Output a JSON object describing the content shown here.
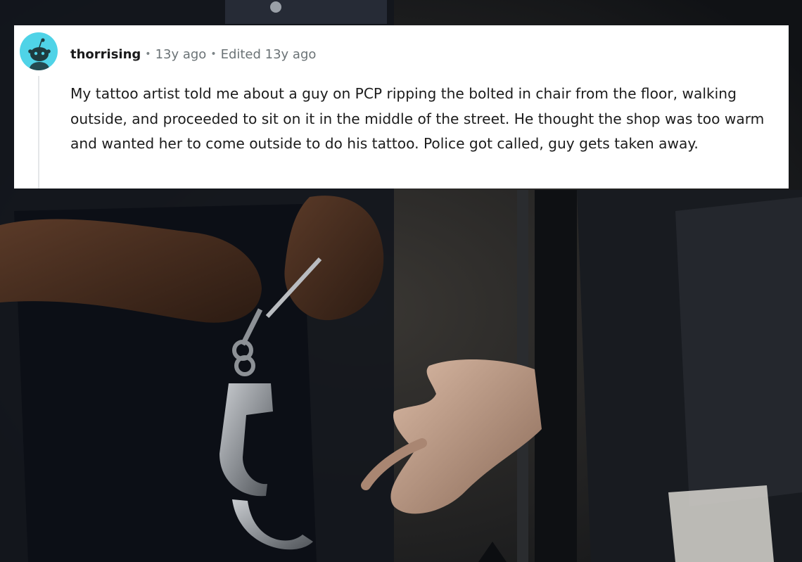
{
  "comment": {
    "username": "thorrising",
    "separator": "•",
    "posted": "13y ago",
    "edited": "Edited 13y ago",
    "body": "My tattoo artist told me about a guy on PCP ripping the bolted in chair from the floor, walking outside, and proceeded to sit on it in the middle of the street. He thought the shop was too warm and wanted her to come outside to do his tattoo. Police got called, guy gets taken away."
  },
  "avatar": {
    "icon": "snoo-icon",
    "color": "#4fd3e7"
  },
  "photo": {
    "subject": "handcuffs-photo"
  }
}
